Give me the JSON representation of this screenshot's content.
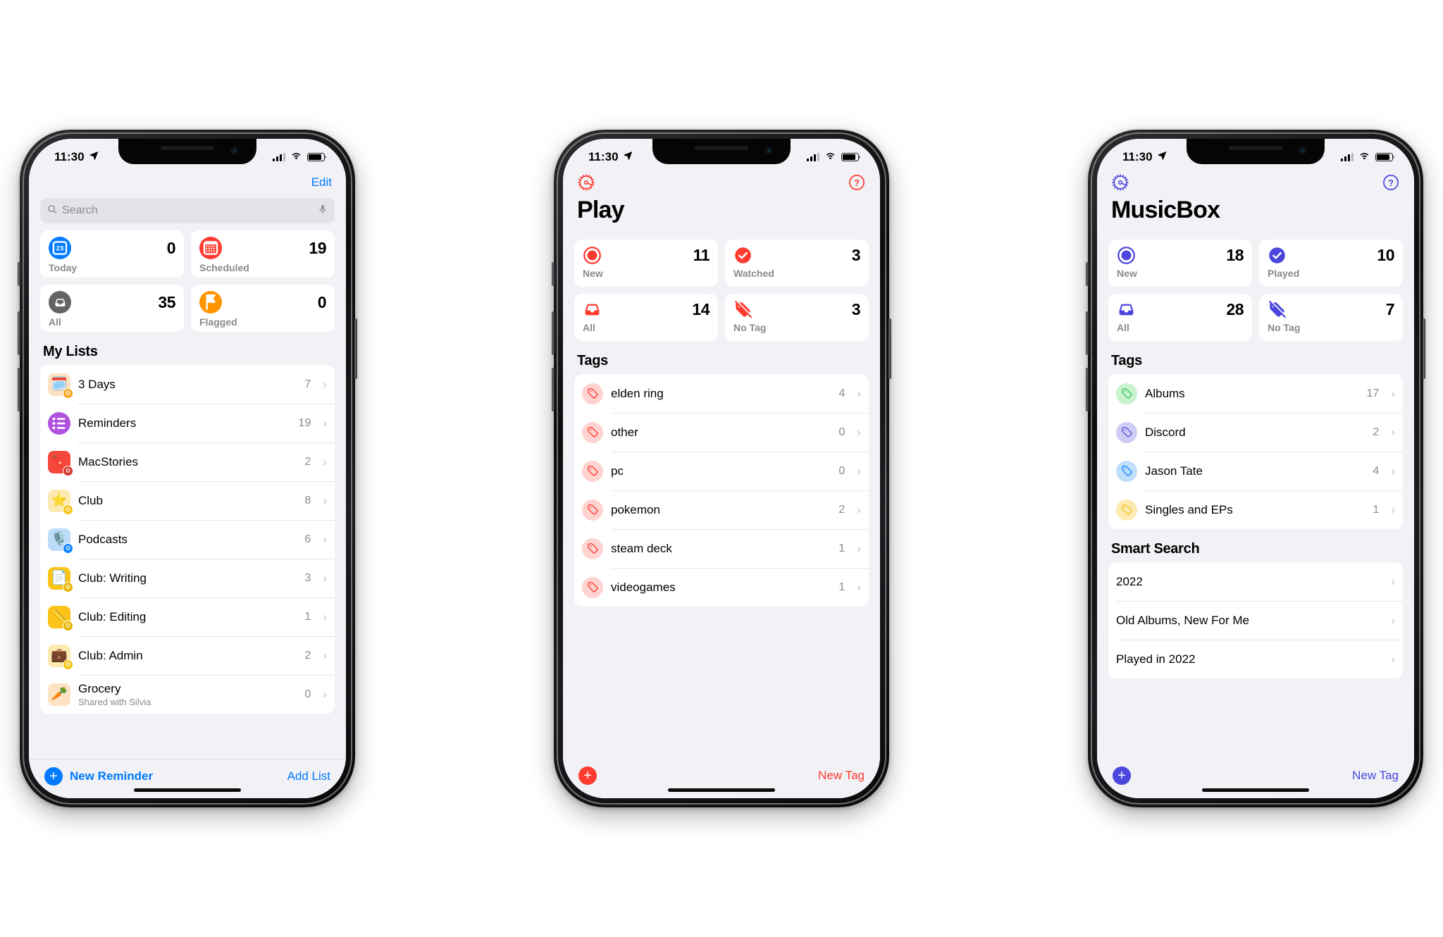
{
  "phones": [
    {
      "id": "reminders",
      "accent": "#007aff",
      "status": {
        "time": "11:30",
        "location_icon": "location-arrow",
        "cellular": "signal-bars",
        "wifi": "wifi-icon",
        "battery": "battery-icon"
      },
      "nav": {
        "edit_label": "Edit"
      },
      "search": {
        "placeholder": "Search",
        "icon": "search-icon",
        "mic_icon": "microphone-icon"
      },
      "cards": [
        {
          "label": "Today",
          "count": "0",
          "icon": "calendar-day-icon",
          "color": "#007aff",
          "glyph": "23"
        },
        {
          "label": "Scheduled",
          "count": "19",
          "icon": "calendar-icon",
          "color": "#ff3b30",
          "glyph": "grid"
        },
        {
          "label": "All",
          "count": "35",
          "icon": "tray-icon",
          "color": "#636366",
          "glyph": "tray"
        },
        {
          "label": "Flagged",
          "count": "0",
          "icon": "flag-icon",
          "color": "#ff9500",
          "glyph": "flag"
        }
      ],
      "sections": [
        {
          "title": "My Lists",
          "rows": [
            {
              "name": "3 Days",
              "count": "7",
              "emoji": "🗓️",
              "tile_bg": "#fde2c3",
              "badge_bg": "#f5a623",
              "badge": "⚙"
            },
            {
              "name": "Reminders",
              "count": "19",
              "icon": "list-icon",
              "circle_bg": "#af52de"
            },
            {
              "name": "MacStories",
              "count": "2",
              "emoji": "🔖",
              "tile_bg": "#f5473c",
              "badge_bg": "#d8372c",
              "badge": "⚙",
              "white_glyph": true
            },
            {
              "name": "Club",
              "count": "8",
              "emoji": "⭐",
              "tile_bg": "#fdeab3",
              "badge_bg": "#f5c518",
              "badge": "⚙"
            },
            {
              "name": "Podcasts",
              "count": "6",
              "emoji": "🎙️",
              "tile_bg": "#bcdcfa",
              "badge_bg": "#0a84ff",
              "badge": "⚙"
            },
            {
              "name": "Club: Writing",
              "count": "3",
              "emoji": "📄",
              "tile_bg": "#fcc418",
              "badge_bg": "#e8b400",
              "badge": "⚙",
              "white_glyph": true
            },
            {
              "name": "Club: Editing",
              "count": "1",
              "emoji": "📏",
              "tile_bg": "#fcc418",
              "badge_bg": "#e8b400",
              "badge": "⚙"
            },
            {
              "name": "Club: Admin",
              "count": "2",
              "emoji": "💼",
              "tile_bg": "#fdeab3",
              "badge_bg": "#f5c518",
              "badge": "⚙"
            },
            {
              "name": "Grocery",
              "sub": "Shared with Silvia",
              "count": "0",
              "emoji": "🥕",
              "tile_bg": "#fde2c3",
              "badge_bg": "#f5a623",
              "badge": ""
            }
          ]
        }
      ],
      "toolbar": {
        "plus_icon": "plus-circle-icon",
        "left_label": "New Reminder",
        "right_label": "Add List",
        "bordered": true
      }
    },
    {
      "id": "play",
      "accent": "#ff3b30",
      "status": {
        "time": "11:30",
        "location_icon": "location-arrow",
        "cellular": "signal-bars",
        "wifi": "wifi-icon",
        "battery": "battery-icon"
      },
      "nav": {
        "gear_icon": "gear-icon",
        "help_icon": "question-mark-circle-icon"
      },
      "title": "Play",
      "cards": [
        {
          "label": "New",
          "count": "11",
          "icon": "record-circle-icon",
          "color": "#ff3b30"
        },
        {
          "label": "Watched",
          "count": "3",
          "icon": "checkmark-circle-icon",
          "color": "#ff3b30"
        },
        {
          "label": "All",
          "count": "14",
          "icon": "tray-icon",
          "color": "#ff3b30"
        },
        {
          "label": "No Tag",
          "count": "3",
          "icon": "tag-slash-icon",
          "color": "#ff3b30"
        }
      ],
      "sections": [
        {
          "title": "Tags",
          "rows": [
            {
              "name": "elden ring",
              "count": "4",
              "icon": "tag-icon",
              "tag_bg": "#ffd4d0",
              "tag_fg": "#ff3b30"
            },
            {
              "name": "other",
              "count": "0",
              "icon": "tag-icon",
              "tag_bg": "#ffd4d0",
              "tag_fg": "#ff3b30"
            },
            {
              "name": "pc",
              "count": "0",
              "icon": "tag-icon",
              "tag_bg": "#ffd4d0",
              "tag_fg": "#ff3b30"
            },
            {
              "name": "pokemon",
              "count": "2",
              "icon": "tag-icon",
              "tag_bg": "#ffd4d0",
              "tag_fg": "#ff3b30"
            },
            {
              "name": "steam deck",
              "count": "1",
              "icon": "tag-icon",
              "tag_bg": "#ffd4d0",
              "tag_fg": "#ff3b30"
            },
            {
              "name": "videogames",
              "count": "1",
              "icon": "tag-icon",
              "tag_bg": "#ffd4d0",
              "tag_fg": "#ff3b30"
            }
          ]
        }
      ],
      "toolbar": {
        "plus_icon": "plus-circle-icon",
        "left_label": "",
        "right_label": "New Tag",
        "bordered": false
      }
    },
    {
      "id": "musicbox",
      "accent": "#4b46dd",
      "status": {
        "time": "11:30",
        "location_icon": "location-arrow",
        "cellular": "signal-bars",
        "wifi": "wifi-icon",
        "battery": "battery-icon"
      },
      "nav": {
        "gear_icon": "gear-icon",
        "help_icon": "question-mark-circle-icon"
      },
      "title": "MusicBox",
      "cards": [
        {
          "label": "New",
          "count": "18",
          "icon": "record-circle-icon",
          "color": "#4b46dd"
        },
        {
          "label": "Played",
          "count": "10",
          "icon": "checkmark-circle-icon",
          "color": "#4b46dd"
        },
        {
          "label": "All",
          "count": "28",
          "icon": "tray-icon",
          "color": "#4b46dd"
        },
        {
          "label": "No Tag",
          "count": "7",
          "icon": "tag-slash-icon",
          "color": "#4b46dd"
        }
      ],
      "sections": [
        {
          "title": "Tags",
          "rows": [
            {
              "name": "Albums",
              "count": "17",
              "icon": "tag-icon",
              "tag_bg": "#c9f2cf",
              "tag_fg": "#34c759"
            },
            {
              "name": "Discord",
              "count": "2",
              "icon": "tag-icon",
              "tag_bg": "#cfcdf5",
              "tag_fg": "#5856d6"
            },
            {
              "name": "Jason Tate",
              "count": "4",
              "icon": "tag-icon",
              "tag_bg": "#bfdffc",
              "tag_fg": "#0a84ff"
            },
            {
              "name": "Singles and EPs",
              "count": "1",
              "icon": "tag-icon",
              "tag_bg": "#fdeab3",
              "tag_fg": "#f5c518"
            }
          ]
        },
        {
          "title": "Smart Search",
          "rows": [
            {
              "name": "2022",
              "count": ""
            },
            {
              "name": "Old Albums, New For Me",
              "count": ""
            },
            {
              "name": "Played in 2022",
              "count": ""
            }
          ]
        }
      ],
      "toolbar": {
        "plus_icon": "plus-circle-icon",
        "left_label": "",
        "right_label": "New Tag",
        "bordered": false
      }
    }
  ]
}
